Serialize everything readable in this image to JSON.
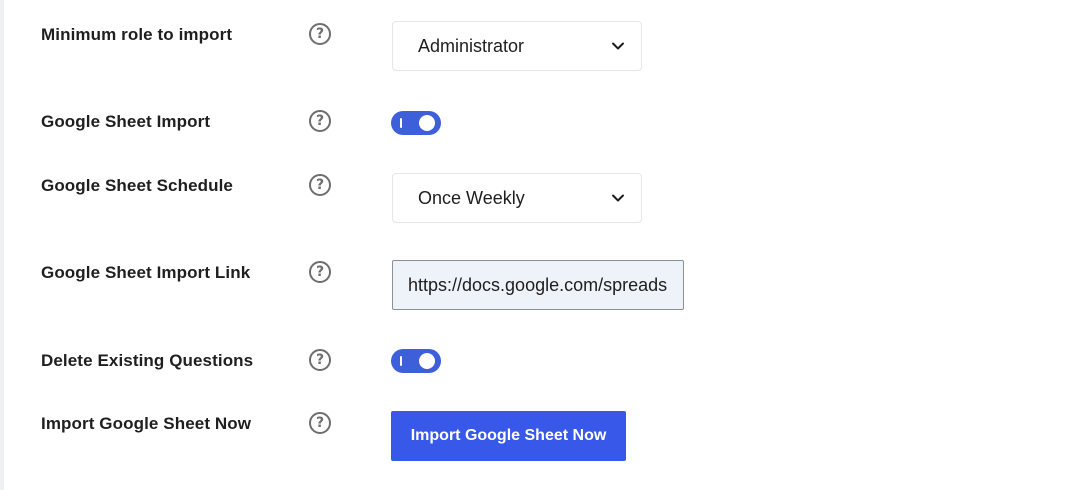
{
  "settings": {
    "rows": [
      {
        "label": "Minimum role to import",
        "help": "?",
        "control": "select",
        "value": "Administrator"
      },
      {
        "label": "Google Sheet Import",
        "help": "?",
        "control": "toggle",
        "checked": true
      },
      {
        "label": "Google Sheet Schedule",
        "help": "?",
        "control": "select",
        "value": "Once Weekly"
      },
      {
        "label": "Google Sheet Import Link",
        "help": "?",
        "control": "text",
        "value": "https://docs.google.com/spreadsheets"
      },
      {
        "label": "Delete Existing Questions",
        "help": "?",
        "control": "toggle",
        "checked": true
      },
      {
        "label": "Import Google Sheet Now",
        "help": "?",
        "control": "button",
        "button_label": "Import Google Sheet Now"
      }
    ]
  },
  "icons": {
    "help": "help-circle-icon",
    "chevron": "chevron-down-icon"
  },
  "colors": {
    "accent": "#3d5fd9",
    "button": "#3858e9",
    "input_bg": "#eef2f9"
  }
}
